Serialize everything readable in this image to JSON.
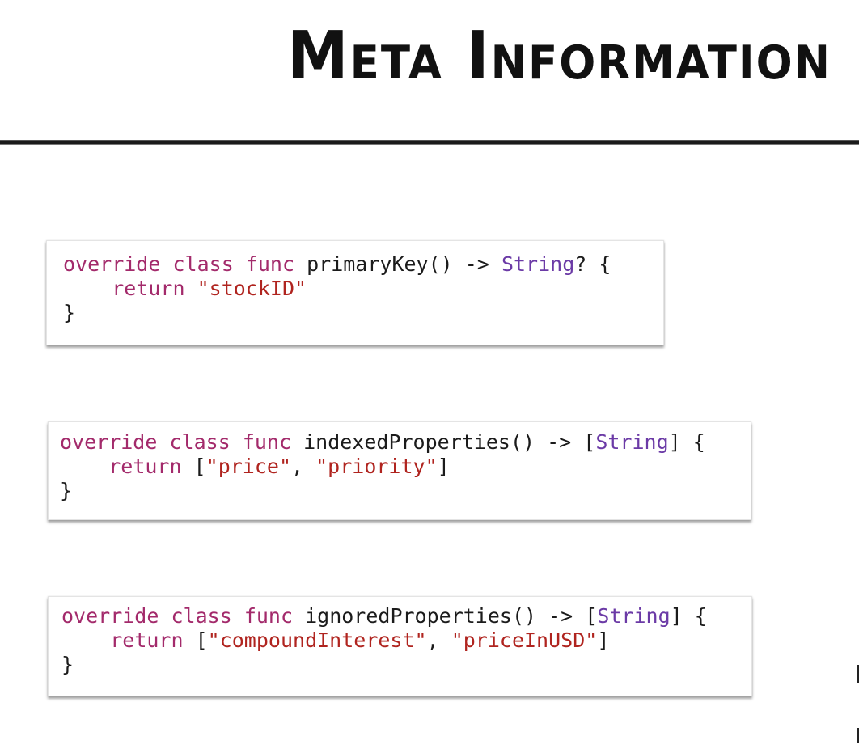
{
  "title": "Meta Information",
  "snippets": [
    {
      "name": "primary-key",
      "line1": {
        "kw1": "override",
        "kw2": "class",
        "kw3": "func",
        "fn": "primaryKey() ->",
        "type": "String",
        "tail": "? {"
      },
      "line2": {
        "kw": "return",
        "str1": "\"stockID\""
      },
      "line3": "}"
    },
    {
      "name": "indexed-properties",
      "line1": {
        "kw1": "override",
        "kw2": "class",
        "kw3": "func",
        "fn": "indexedProperties() -> [",
        "type": "String",
        "tail": "] {"
      },
      "line2": {
        "kw": "return",
        "open": "[",
        "str1": "\"price\"",
        "sep": ", ",
        "str2": "\"priority\"",
        "close": "]"
      },
      "line3": "}"
    },
    {
      "name": "ignored-properties",
      "line1": {
        "kw1": "override",
        "kw2": "class",
        "kw3": "func",
        "fn": "ignoredProperties() -> [",
        "type": "String",
        "tail": "] {"
      },
      "line2": {
        "kw": "return",
        "open": "[",
        "str1": "\"compoundInterest\"",
        "sep": ", ",
        "str2": "\"priceInUSD\"",
        "close": "]"
      },
      "line3": "}"
    }
  ],
  "colors": {
    "keyword": "#a32a6b",
    "string": "#b0241f",
    "type": "#6b3aa6",
    "text": "#1b1b1b",
    "rule": "#1a1a1a"
  }
}
